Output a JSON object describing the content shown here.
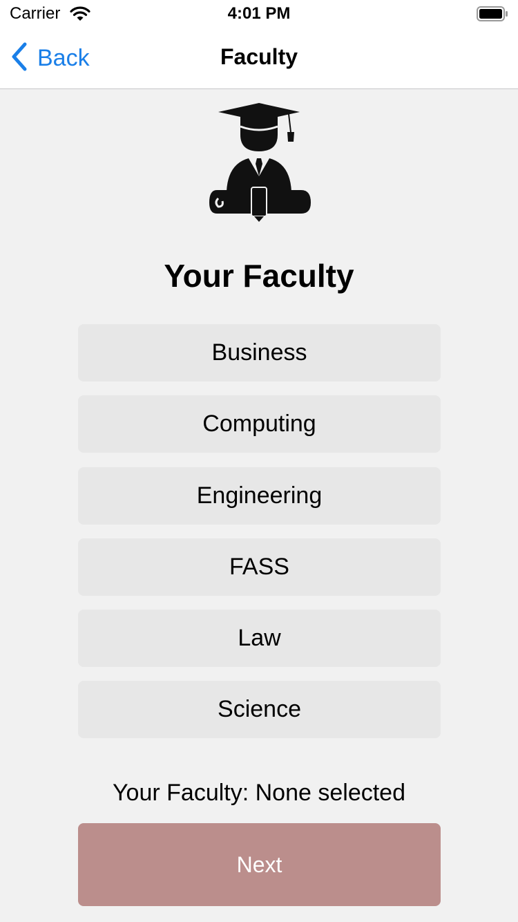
{
  "status_bar": {
    "carrier": "Carrier",
    "time": "4:01 PM"
  },
  "nav": {
    "back_label": "Back",
    "title": "Faculty"
  },
  "page": {
    "icon": "graduate-icon",
    "title": "Your Faculty"
  },
  "faculties": [
    {
      "label": "Business"
    },
    {
      "label": "Computing"
    },
    {
      "label": "Engineering"
    },
    {
      "label": "FASS"
    },
    {
      "label": "Law"
    },
    {
      "label": "Science"
    }
  ],
  "selection": {
    "status_text": "Your Faculty: None selected"
  },
  "next_button": {
    "label": "Next"
  },
  "colors": {
    "accent": "#1a7fe8",
    "background": "#f1f1f1",
    "option_button": "#e7e7e7",
    "next_button": "#bb8e8c"
  }
}
